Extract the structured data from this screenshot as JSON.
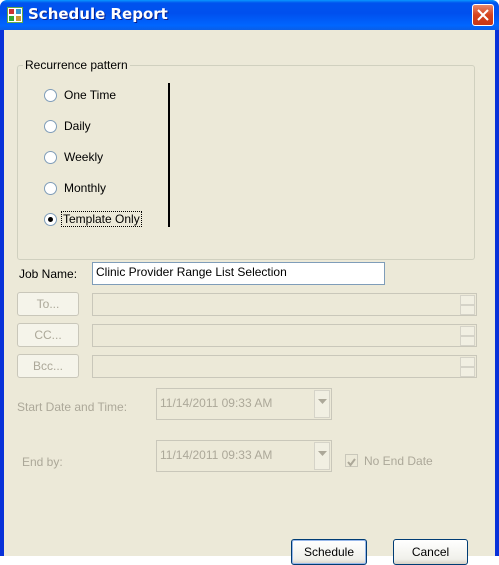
{
  "window": {
    "title": "Schedule Report"
  },
  "recurrence": {
    "legend": "Recurrence pattern",
    "options": [
      {
        "label": "One Time",
        "checked": false
      },
      {
        "label": "Daily",
        "checked": false
      },
      {
        "label": "Weekly",
        "checked": false
      },
      {
        "label": "Monthly",
        "checked": false
      },
      {
        "label": "Template Only",
        "checked": true
      }
    ]
  },
  "job": {
    "label": "Job Name:",
    "value": "Clinic Provider Range List Selection"
  },
  "recipients": {
    "to_label": "To...",
    "cc_label": "CC...",
    "bcc_label": "Bcc..."
  },
  "start": {
    "label": "Start Date and Time:",
    "value": "11/14/2011 09:33 AM"
  },
  "end": {
    "label": "End by:",
    "value": "11/14/2011 09:33 AM",
    "no_end_label": "No End Date",
    "no_end_checked": true
  },
  "buttons": {
    "schedule": "Schedule",
    "cancel": "Cancel"
  }
}
